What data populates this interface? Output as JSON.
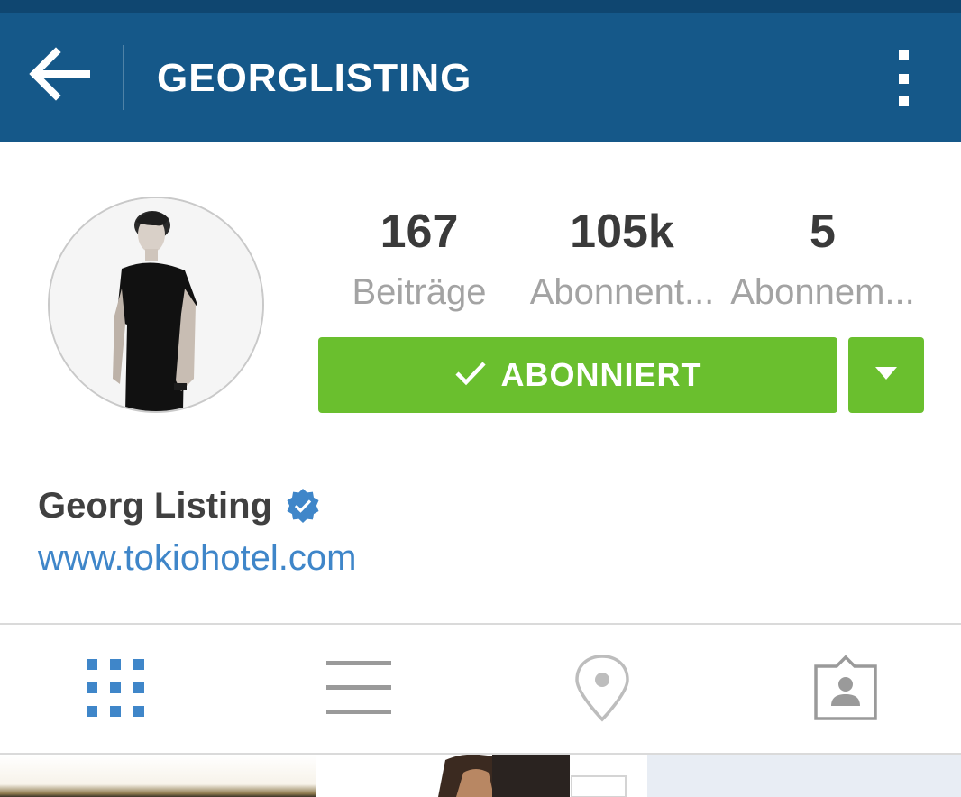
{
  "header": {
    "title": "GEORGLISTING"
  },
  "profile": {
    "stats": [
      {
        "value": "167",
        "label": "Beiträge"
      },
      {
        "value": "105k",
        "label": "Abonnent..."
      },
      {
        "value": "5",
        "label": "Abonnem..."
      }
    ],
    "follow_button_label": "ABONNIERT",
    "full_name": "Georg Listing",
    "website": "www.tokiohotel.com"
  },
  "colors": {
    "header_bg": "#155889",
    "follow_green": "#6abf2e",
    "active_tab_blue": "#3f86c9",
    "link_blue": "#3f86c9",
    "verified_blue": "#3f86c9"
  },
  "icons": {
    "back": "arrow-left-icon",
    "more": "more-vertical-icon",
    "follow_check": "check-icon",
    "dropdown": "caret-down-icon",
    "verified": "verified-badge-icon",
    "grid_tab": "grid-icon",
    "list_tab": "list-icon",
    "location_tab": "location-pin-icon",
    "tagged_tab": "tagged-person-icon"
  },
  "tabs": {
    "active": "grid"
  }
}
